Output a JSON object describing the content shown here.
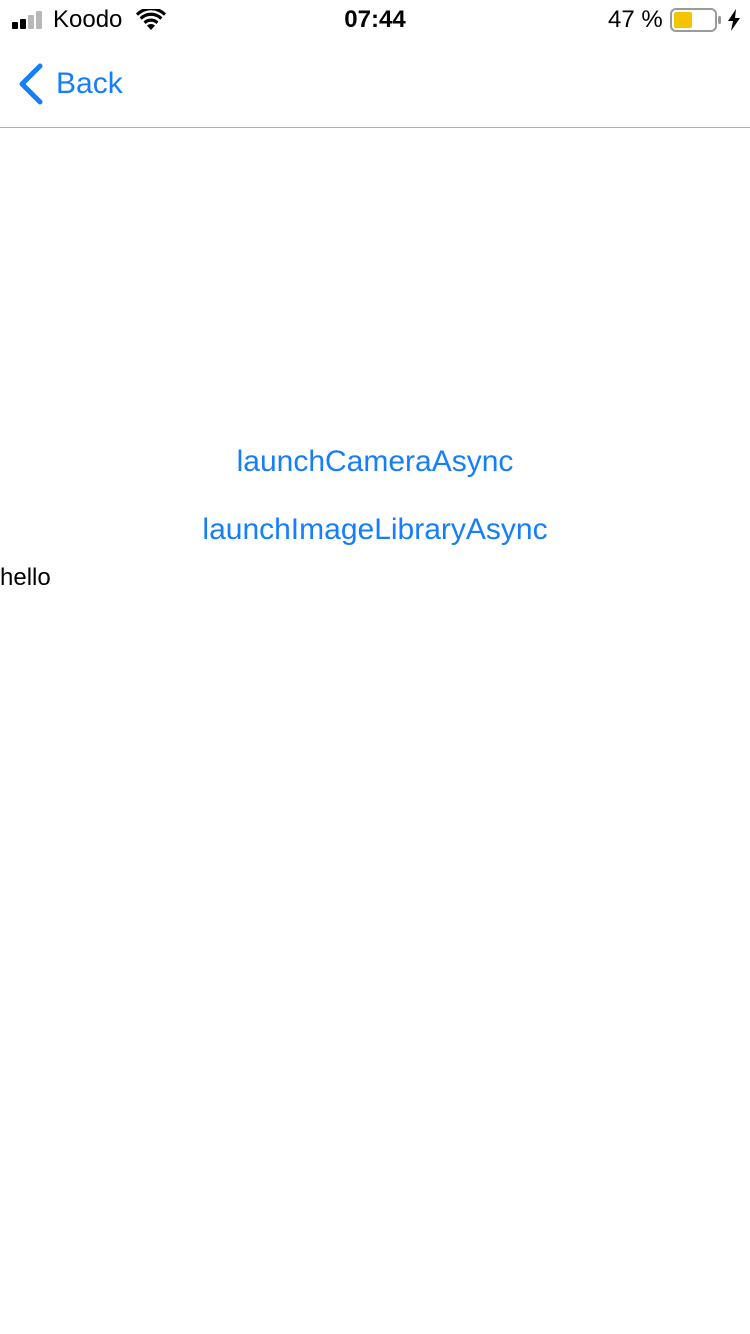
{
  "status_bar": {
    "carrier": "Koodo",
    "time": "07:44",
    "battery_percent": "47 %",
    "battery_level": 0.47,
    "charging": true,
    "signal_bars_filled": 2,
    "signal_bars_total": 4,
    "icons": [
      "signal-icon",
      "wifi-icon",
      "battery-icon",
      "charging-bolt-icon"
    ]
  },
  "nav": {
    "back_label": "Back",
    "back_icon": "chevron-left-icon"
  },
  "main": {
    "camera_button_label": "launchCameraAsync",
    "library_button_label": "launchImageLibraryAsync",
    "hello_text": "hello"
  },
  "colors": {
    "accent": "#147efb",
    "battery_fill": "#f5c400",
    "divider": "#b2b2b2"
  }
}
